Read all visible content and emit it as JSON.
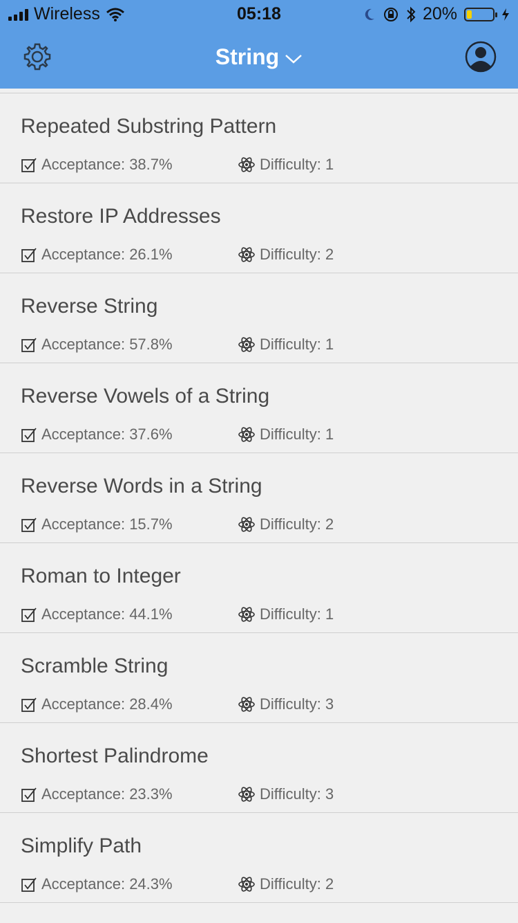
{
  "status_bar": {
    "carrier": "Wireless",
    "time": "05:18",
    "battery_percent": "20%",
    "battery_level": 0.2
  },
  "navbar": {
    "title": "String",
    "left_icon": "gear-icon",
    "title_icon": "chevron-down-icon",
    "right_icon": "user-avatar-icon",
    "bg_color": "#5b9de4"
  },
  "problems": [
    {
      "title": "Repeated Substring Pattern",
      "acceptance": "Acceptance: 38.7%",
      "difficulty": "Difficulty: 1"
    },
    {
      "title": "Restore IP Addresses",
      "acceptance": "Acceptance: 26.1%",
      "difficulty": "Difficulty: 2"
    },
    {
      "title": "Reverse String",
      "acceptance": "Acceptance: 57.8%",
      "difficulty": "Difficulty: 1"
    },
    {
      "title": "Reverse Vowels of a String",
      "acceptance": "Acceptance: 37.6%",
      "difficulty": "Difficulty: 1"
    },
    {
      "title": "Reverse Words in a String",
      "acceptance": "Acceptance: 15.7%",
      "difficulty": "Difficulty: 2"
    },
    {
      "title": "Roman to Integer",
      "acceptance": "Acceptance: 44.1%",
      "difficulty": "Difficulty: 1"
    },
    {
      "title": "Scramble String",
      "acceptance": "Acceptance: 28.4%",
      "difficulty": "Difficulty: 3"
    },
    {
      "title": "Shortest Palindrome",
      "acceptance": "Acceptance: 23.3%",
      "difficulty": "Difficulty: 3"
    },
    {
      "title": "Simplify Path",
      "acceptance": "Acceptance: 24.3%",
      "difficulty": "Difficulty: 2"
    }
  ]
}
